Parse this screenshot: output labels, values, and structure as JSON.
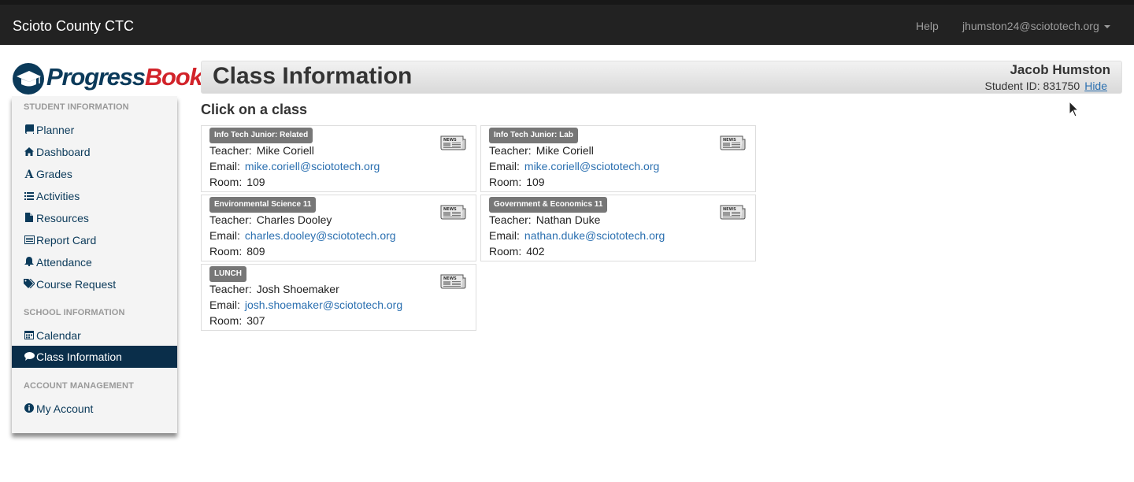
{
  "navbar": {
    "brand": "Scioto County CTC",
    "help": "Help",
    "user": "jhumston24@sciototech.org"
  },
  "logo": {
    "part1": "Progress",
    "part2": "Book"
  },
  "sidebar": {
    "student_heading": "STUDENT INFORMATION",
    "student_items": [
      {
        "label": "Planner",
        "icon": "book-icon"
      },
      {
        "label": "Dashboard",
        "icon": "home-icon"
      },
      {
        "label": "Grades",
        "icon": "font-icon"
      },
      {
        "label": "Activities",
        "icon": "list-icon"
      },
      {
        "label": "Resources",
        "icon": "file-icon"
      },
      {
        "label": "Report Card",
        "icon": "list-alt-icon"
      },
      {
        "label": "Attendance",
        "icon": "bell-icon"
      },
      {
        "label": "Course Request",
        "icon": "tags-icon"
      }
    ],
    "school_heading": "SCHOOL INFORMATION",
    "school_items": [
      {
        "label": "Calendar",
        "icon": "calendar-icon"
      },
      {
        "label": "Class Information",
        "icon": "comment-icon"
      }
    ],
    "account_heading": "ACCOUNT MANAGEMENT",
    "account_items": [
      {
        "label": "My Account",
        "icon": "info-icon"
      }
    ]
  },
  "header": {
    "title": "Class Information",
    "student_name": "Jacob Humston",
    "student_id_label": "Student ID:",
    "student_id": "831750",
    "hide": "Hide"
  },
  "main": {
    "heading": "Click on a class",
    "teacher_label": "Teacher:",
    "email_label": "Email:",
    "room_label": "Room:",
    "classes": [
      {
        "name": "Info Tech Junior: Related",
        "teacher": "Mike Coriell",
        "email": "mike.coriell@sciototech.org",
        "room": "109"
      },
      {
        "name": "Info Tech Junior: Lab",
        "teacher": "Mike Coriell",
        "email": "mike.coriell@sciototech.org",
        "room": "109"
      },
      {
        "name": "Environmental Science 11",
        "teacher": "Charles Dooley",
        "email": "charles.dooley@sciototech.org",
        "room": "809"
      },
      {
        "name": "Government & Economics 11",
        "teacher": "Nathan Duke",
        "email": "nathan.duke@sciototech.org",
        "room": "402"
      },
      {
        "name": "LUNCH",
        "teacher": "Josh Shoemaker",
        "email": "josh.shoemaker@sciototech.org",
        "room": "307"
      }
    ]
  },
  "colors": {
    "navbar_bg": "#222222",
    "sidebar_active": "#0a2e4a",
    "link": "#2a6fb0",
    "badge": "#777777"
  }
}
